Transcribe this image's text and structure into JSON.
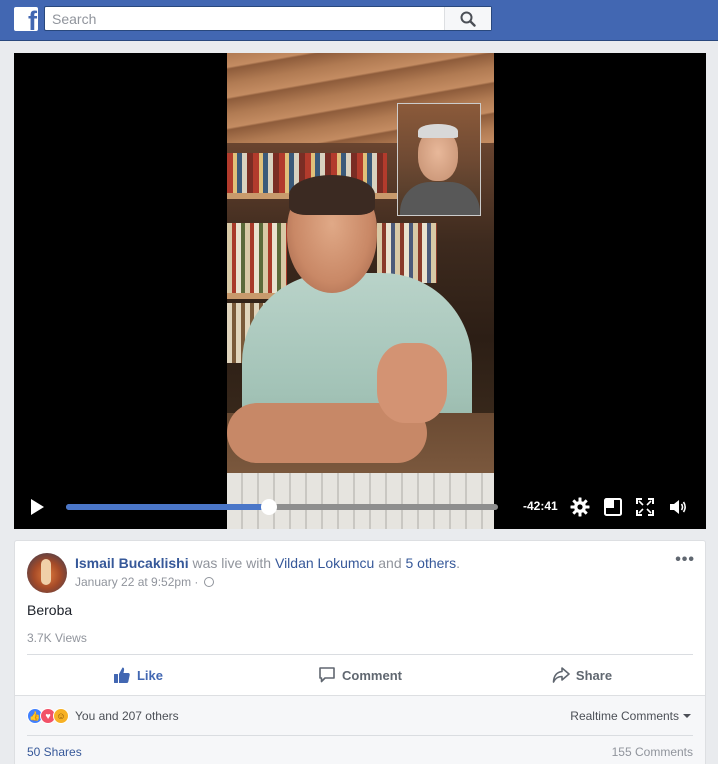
{
  "topbar": {
    "logo": "f",
    "search_placeholder": "Search",
    "search_icon": "magnifier-icon"
  },
  "video": {
    "progress": 0.47,
    "time_remaining": "-42:41",
    "icons": [
      "play-icon",
      "gear-icon",
      "picture-in-picture-icon",
      "fullscreen-icon",
      "volume-icon"
    ],
    "accent": "#4a76c8"
  },
  "post": {
    "author": "Ismail Bucaklishi",
    "live_text": "was live with",
    "with_user": "Vildan Lokumcu",
    "and_text": "and",
    "others_link": "5 others",
    "period": ".",
    "timestamp": "January 22 at 9:52pm",
    "meta_sep": "·",
    "text": "Beroba",
    "views": "3.7K Views",
    "more": "•••",
    "actions": {
      "like": "Like",
      "comment": "Comment",
      "share": "Share"
    },
    "reactions_text": "You and 207 others",
    "realtime_comments": "Realtime Comments",
    "shares": "50 Shares",
    "comments": "155 Comments",
    "like_color": "#4267b2"
  }
}
